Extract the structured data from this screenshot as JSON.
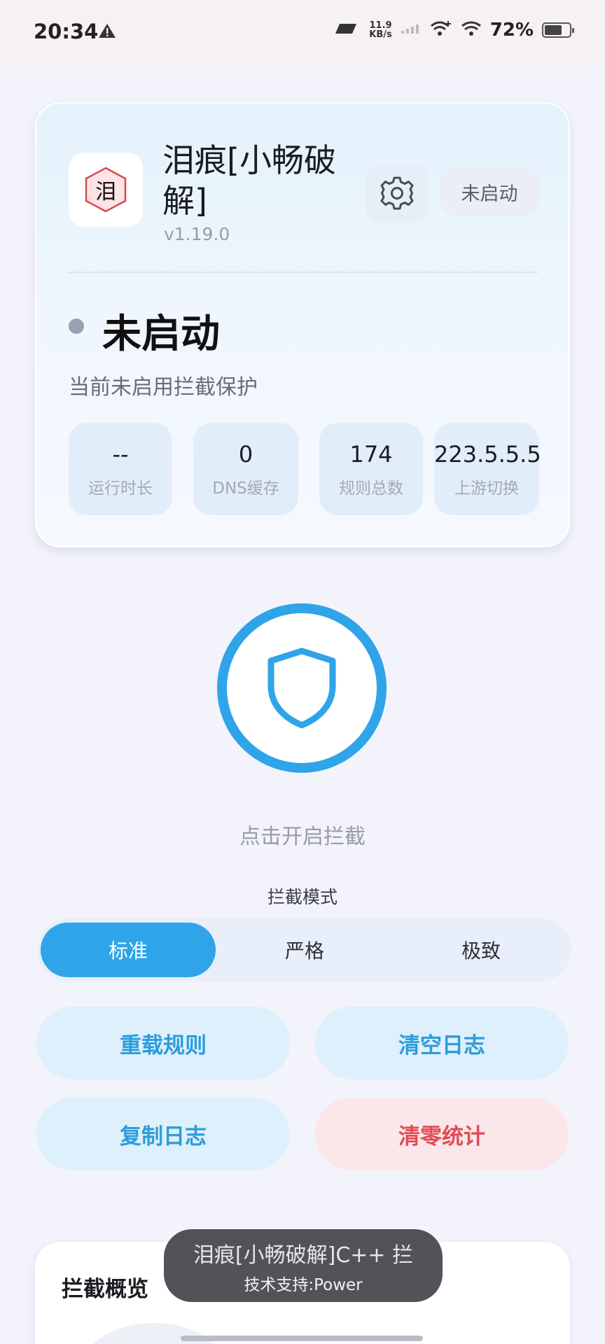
{
  "status_bar": {
    "time": "20:34",
    "net_speed_value": "11.9",
    "net_speed_unit": "KB/s",
    "battery_text": "72%",
    "battery_level": 0.72
  },
  "header_card": {
    "app_icon_char": "泪",
    "app_name": "泪痕[小畅破解]",
    "version": "v1.19.0",
    "status_pill": "未启动",
    "status_title": "未启动",
    "status_desc": "当前未启用拦截保护",
    "stats": [
      {
        "value": "--",
        "label": "运行时长"
      },
      {
        "value": "0",
        "label": "DNS缓存"
      },
      {
        "value": "174",
        "label": "规则总数"
      },
      {
        "value": "223.5.5.5",
        "label": "上游切换"
      }
    ]
  },
  "power": {
    "hint": "点击开启拦截"
  },
  "mode": {
    "label": "拦截模式",
    "options": [
      "标准",
      "严格",
      "极致"
    ],
    "selected": "标准"
  },
  "actions": {
    "reload_rules": "重载规则",
    "clear_logs": "清空日志",
    "copy_logs": "复制日志",
    "reset_stats": "清零统计"
  },
  "overview": {
    "title": "拦截概览"
  },
  "toast": {
    "line1": "泪痕[小畅破解]C++ 拦",
    "line2": "技术支持:Power"
  },
  "colors": {
    "accent": "#2fa4e9",
    "danger": "#e14c55",
    "background": "#f2f3fb"
  }
}
